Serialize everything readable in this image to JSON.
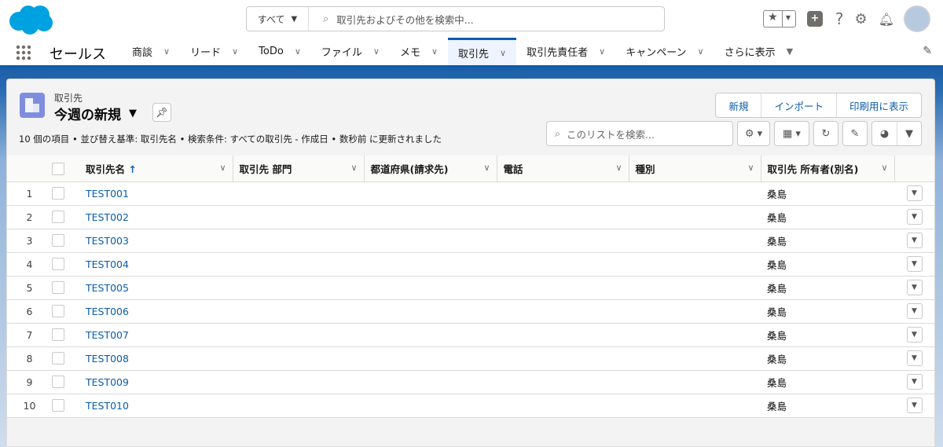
{
  "header": {
    "search_scope": "すべて",
    "search_placeholder": "取引先およびその他を検索中..."
  },
  "nav": {
    "app_name": "セールス",
    "tabs": [
      {
        "label": "商談"
      },
      {
        "label": "リード"
      },
      {
        "label": "ToDo"
      },
      {
        "label": "ファイル"
      },
      {
        "label": "メモ"
      },
      {
        "label": "取引先",
        "active": true
      },
      {
        "label": "取引先責任者"
      },
      {
        "label": "キャンペーン"
      }
    ],
    "more": "さらに表示"
  },
  "list": {
    "object_label": "取引先",
    "view_name": "今週の新規",
    "meta": "10 個の項目 • 並び替え基準: 取引先名 • 検索条件: すべての取引先 - 作成日 • 数秒前 に更新されました",
    "buttons": {
      "new": "新規",
      "import": "インポート",
      "print": "印刷用に表示"
    },
    "search_placeholder": "このリストを検索..."
  },
  "columns": [
    "取引先名",
    "取引先 部門",
    "都道府県(請求先)",
    "電話",
    "種別",
    "取引先 所有者(別名)"
  ],
  "rows": [
    {
      "n": "1",
      "name": "TEST001",
      "owner": "桑島"
    },
    {
      "n": "2",
      "name": "TEST002",
      "owner": "桑島"
    },
    {
      "n": "3",
      "name": "TEST003",
      "owner": "桑島"
    },
    {
      "n": "4",
      "name": "TEST004",
      "owner": "桑島"
    },
    {
      "n": "5",
      "name": "TEST005",
      "owner": "桑島"
    },
    {
      "n": "6",
      "name": "TEST006",
      "owner": "桑島"
    },
    {
      "n": "7",
      "name": "TEST007",
      "owner": "桑島"
    },
    {
      "n": "8",
      "name": "TEST008",
      "owner": "桑島"
    },
    {
      "n": "9",
      "name": "TEST009",
      "owner": "桑島"
    },
    {
      "n": "10",
      "name": "TEST010",
      "owner": "桑島"
    }
  ],
  "colors": {
    "brand": "#0b5cab",
    "logo": "#00a1e0",
    "object_icon": "#7f8de1"
  }
}
